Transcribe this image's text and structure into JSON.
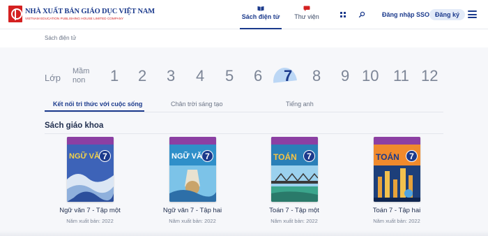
{
  "header": {
    "logo_title": "NHÀ XUẤT BẢN GIÁO DỤC VIỆT NAM",
    "logo_subtitle": "VIETNAM EDUCATION PUBLISHING HOUSE LIMITED COMPANY",
    "nav": [
      {
        "label": "Sách điện tử",
        "icon": "book-icon",
        "active": true
      },
      {
        "label": "Thư viện",
        "icon": "chat-icon",
        "active": false
      }
    ],
    "sso_label": "Đăng nhập SSO",
    "register_label": "Đăng ký",
    "accent_color": "#1b3a8c",
    "brand_red": "#d42121"
  },
  "breadcrumb": "Sách điện tử",
  "grades": {
    "label": "Lớp",
    "preschool_line1": "Mầm",
    "preschool_line2": "non",
    "items": [
      "1",
      "2",
      "3",
      "4",
      "5",
      "6",
      "7",
      "8",
      "9",
      "10",
      "11",
      "12"
    ],
    "selected": "7"
  },
  "series_tabs": [
    {
      "label": "Kết nối tri thức với cuộc sống",
      "active": true
    },
    {
      "label": "Chân trời sáng tạo",
      "active": false
    },
    {
      "label": "Tiếng anh",
      "active": false
    }
  ],
  "section_title": "Sách giáo khoa",
  "books": [
    {
      "title": "Ngữ văn 7 - Tập một",
      "year": "Năm xuất bản: 2022",
      "cover_name": "NGỮ VĂN",
      "cover_grade": "7"
    },
    {
      "title": "Ngữ văn 7 - Tập hai",
      "year": "Năm xuất bản: 2022",
      "cover_name": "NGỮ VĂN",
      "cover_grade": "7"
    },
    {
      "title": "Toán 7 - Tập một",
      "year": "Năm xuất bản: 2022",
      "cover_name": "TOÁN",
      "cover_grade": "7"
    },
    {
      "title": "Toán 7 - Tập hai",
      "year": "Năm xuất bản: 2022",
      "cover_name": "TOÁN",
      "cover_grade": "7"
    }
  ]
}
